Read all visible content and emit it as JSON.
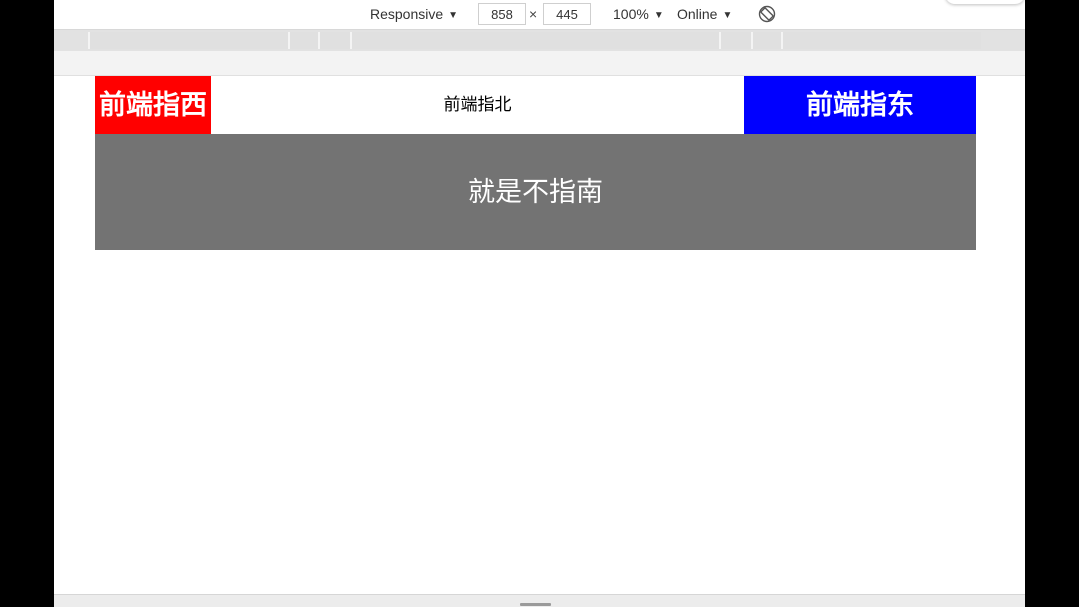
{
  "toolbar": {
    "device_label": "Responsive",
    "width_value": "858",
    "times_symbol": "×",
    "height_value": "445",
    "zoom_label": "100%",
    "throttle_label": "Online",
    "dropdown_arrow": "▼"
  },
  "page": {
    "west_text": "前端指西",
    "north_text": "前端指北",
    "east_text": "前端指东",
    "south_text": "就是不指南"
  },
  "colors": {
    "west_bg": "#ff0000",
    "east_bg": "#0000ff",
    "south_bg": "#737373"
  },
  "icons": {
    "rotate": "rotate-device-icon",
    "resize": "resize-handle"
  }
}
